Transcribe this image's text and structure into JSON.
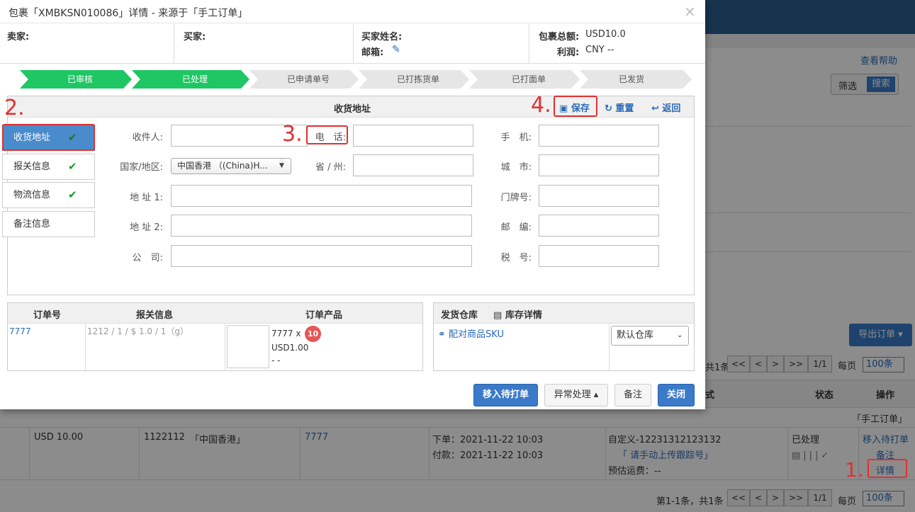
{
  "background": {
    "help_link": "查看帮助",
    "filter_label": "筛选",
    "search_label": "搜索",
    "export_label": "导出订单 ▾",
    "pager_top": {
      "count_suffix": "共1条",
      "first": "<<",
      "prev": "<",
      "next": ">",
      "last": ">>",
      "page": "1/1",
      "per_page_label": "每页",
      "per_page_value": "100条"
    },
    "table_header": {
      "col_method": "式",
      "col_status": "状态",
      "col_actions": "操作"
    },
    "group_label": "「手工订单」",
    "row": {
      "amount": "USD 10.00",
      "id": "1122112",
      "region": "「中国香港」",
      "order_no": "7777",
      "order_time": "下单：2021-11-22 10:03",
      "pay_time": "付款：2021-11-22 10:03",
      "custom": "自定义-12231312123132",
      "tracking_link": "「 请手动上传跟踪号」",
      "est_shipping": "预估运费：--",
      "status": "已处理",
      "action_move": "移入待打单",
      "action_note": "备注",
      "action_detail": "详情"
    },
    "pager_bottom": {
      "summary": "第1-1条，共1条",
      "first": "<<",
      "prev": "<",
      "next": ">",
      "last": ">>",
      "page": "1/1",
      "per_page_label": "每页",
      "per_page_value": "100条"
    }
  },
  "modal": {
    "title": "包裹「XMBKSN010086」详情 - 来源于「手工订单」",
    "close": "×",
    "info": {
      "seller_label": "卖家:",
      "buyer_label": "买家:",
      "buyer_name_label": "买家姓名:",
      "email_label": "邮箱:",
      "total_label": "包裹总额:",
      "total_value": "USD10.0",
      "profit_label": "利润:",
      "profit_value": "CNY --"
    },
    "steps": [
      {
        "label": "已审核",
        "done": true
      },
      {
        "label": "已处理",
        "done": true
      },
      {
        "label": "已申请单号",
        "done": false
      },
      {
        "label": "已打拣货单",
        "done": false
      },
      {
        "label": "已打面单",
        "done": false
      },
      {
        "label": "已发货",
        "done": false
      }
    ],
    "address_panel": {
      "title": "收货地址",
      "save": "保存",
      "reset": "重置",
      "back": "返回",
      "tabs": [
        {
          "label": "收货地址",
          "checked": true
        },
        {
          "label": "报关信息",
          "checked": true
        },
        {
          "label": "物流信息",
          "checked": true
        },
        {
          "label": "备注信息",
          "checked": false
        }
      ],
      "fields": {
        "recipient": "收件人:",
        "phone": "电　话:",
        "mobile": "手　机:",
        "country": "国家/地区:",
        "country_value": "中国香港 （(China)H...",
        "province": "省 / 州:",
        "city": "城　市:",
        "address1": "地 址 1:",
        "door": "门牌号:",
        "address2": "地 址 2:",
        "zipcode": "邮　编:",
        "company": "公　司:",
        "tax": "税　号:"
      }
    },
    "order_table": {
      "headers": [
        "订单号",
        "报关信息",
        "订单产品"
      ],
      "order_no": "7777",
      "customs": "1212 / 1 / $ 1.0 / 1（g）",
      "product_qty": "7777 x",
      "product_badge": "10",
      "product_price": "USD1.00",
      "product_extra": "- -"
    },
    "warehouse": {
      "title": "发货仓库",
      "stock_link": "库存详情",
      "match_sku": "配对商品SKU",
      "select_value": "默认仓库"
    },
    "footer": {
      "move": "移入待打单",
      "exception": "异常处理 ▴",
      "note": "备注",
      "close": "关闭"
    },
    "markers": [
      "1.",
      "2.",
      "3.",
      "4."
    ]
  },
  "colors": {
    "step_done": "#1ec764",
    "step_todo": "#e6e6e6",
    "accent": "#3a7ac8",
    "marker": "#e23030"
  }
}
